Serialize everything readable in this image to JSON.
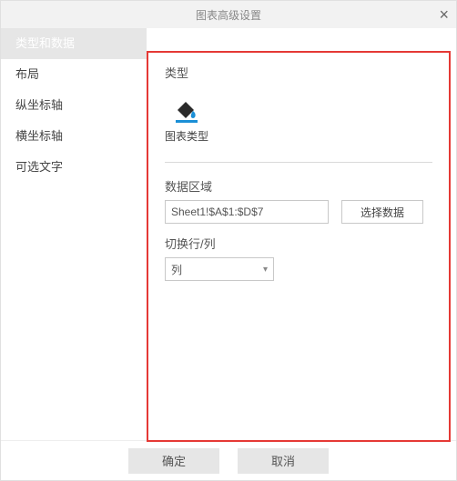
{
  "dialog": {
    "title": "图表高级设置"
  },
  "sidebar": {
    "items": [
      {
        "label": "类型和数据",
        "active": true
      },
      {
        "label": "布局",
        "active": false
      },
      {
        "label": "纵坐标轴",
        "active": false
      },
      {
        "label": "横坐标轴",
        "active": false
      },
      {
        "label": "可选文字",
        "active": false
      }
    ]
  },
  "main": {
    "type_section_label": "类型",
    "chart_type_caption": "图表类型",
    "data_range_label": "数据区域",
    "data_range_value": "Sheet1!$A$1:$D$7",
    "select_data_btn": "选择数据",
    "switch_rowcol_label": "切换行/列",
    "switch_rowcol_value": "列"
  },
  "footer": {
    "ok": "确定",
    "cancel": "取消"
  }
}
